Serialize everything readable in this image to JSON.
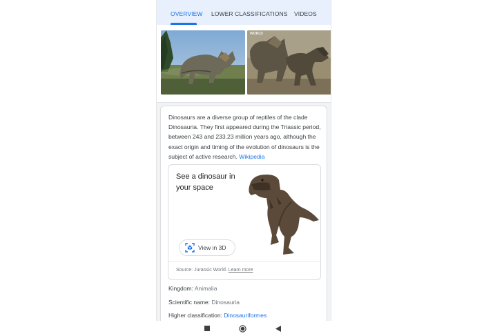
{
  "tabs": [
    {
      "label": "OVERVIEW",
      "active": true
    },
    {
      "label": "LOWER CLASSIFICATIONS",
      "active": false
    },
    {
      "label": "VIDEOS",
      "active": false
    }
  ],
  "gallery": {
    "thumb2_caption": "WORLD"
  },
  "description": {
    "text": "Dinosaurs are a diverse group of reptiles of the clade Dinosauria. They first appeared during the Triassic period, between 243 and 233.23 million years ago, although the exact origin and timing of the evolution of dinosaurs is the subject of active research.",
    "link": "Wikipedia"
  },
  "ar_card": {
    "title": "See a dinosaur in your space",
    "button_label": "View in 3D",
    "source_text": "Source: Jurassic World.",
    "learn_more": "Learn more"
  },
  "facts": {
    "kingdom": {
      "label": "Kingdom:",
      "value": "Animalia"
    },
    "scientific_name": {
      "label": "Scientific name:",
      "value": "Dinosauria"
    },
    "higher_classification": {
      "label": "Higher classification:",
      "value": "Dinosauriformes"
    }
  },
  "colors": {
    "accent": "#1a73e8",
    "tab_bar_bg": "#e8f0fe",
    "page_bg": "#f1f3f4",
    "text": "#3c4043",
    "muted": "#70757a"
  },
  "icons": [
    "view-in-3d-icon",
    "nav-recents-icon",
    "nav-home-icon",
    "nav-back-icon"
  ]
}
